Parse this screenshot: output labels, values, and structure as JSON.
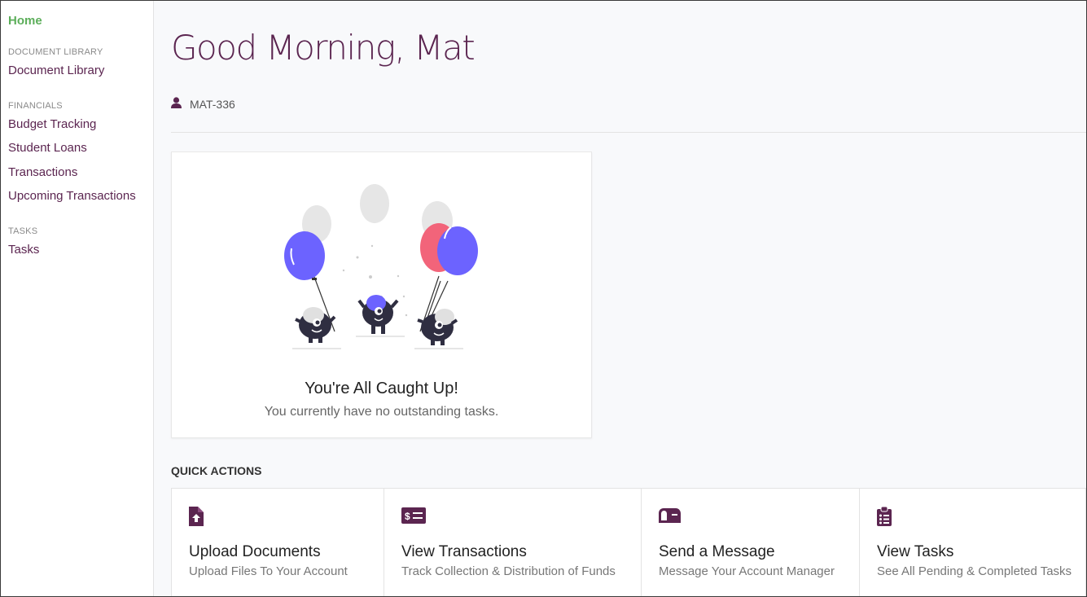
{
  "sidebar": {
    "home_label": "Home",
    "sections": [
      {
        "title": "DOCUMENT LIBRARY",
        "items": [
          "Document Library"
        ]
      },
      {
        "title": "FINANCIALS",
        "items": [
          "Budget Tracking",
          "Student Loans",
          "Transactions",
          "Upcoming Transactions"
        ]
      },
      {
        "title": "TASKS",
        "items": [
          "Tasks"
        ]
      }
    ]
  },
  "header": {
    "greeting": "Good Morning, Mat",
    "account_id": "MAT-336",
    "account_icon": "user-icon"
  },
  "tasks_card": {
    "title": "You're All Caught Up!",
    "subtitle": "You currently have no outstanding tasks."
  },
  "quick_actions": {
    "title": "QUICK ACTIONS",
    "items": [
      {
        "label": "Upload Documents",
        "description": "Upload Files To Your Account",
        "icon": "file-upload-icon"
      },
      {
        "label": "View Transactions",
        "description": "Track Collection & Distribution of Funds",
        "icon": "money-check-icon"
      },
      {
        "label": "Send a Message",
        "description": "Message Your Account Manager",
        "icon": "mailbox-icon"
      },
      {
        "label": "View Tasks",
        "description": "See All Pending & Completed Tasks",
        "icon": "clipboard-list-icon"
      }
    ]
  },
  "colors": {
    "brand": "#5b2550",
    "home_active": "#5cae5a",
    "balloon_blue": "#6c63ff",
    "balloon_red": "#f2647a"
  }
}
